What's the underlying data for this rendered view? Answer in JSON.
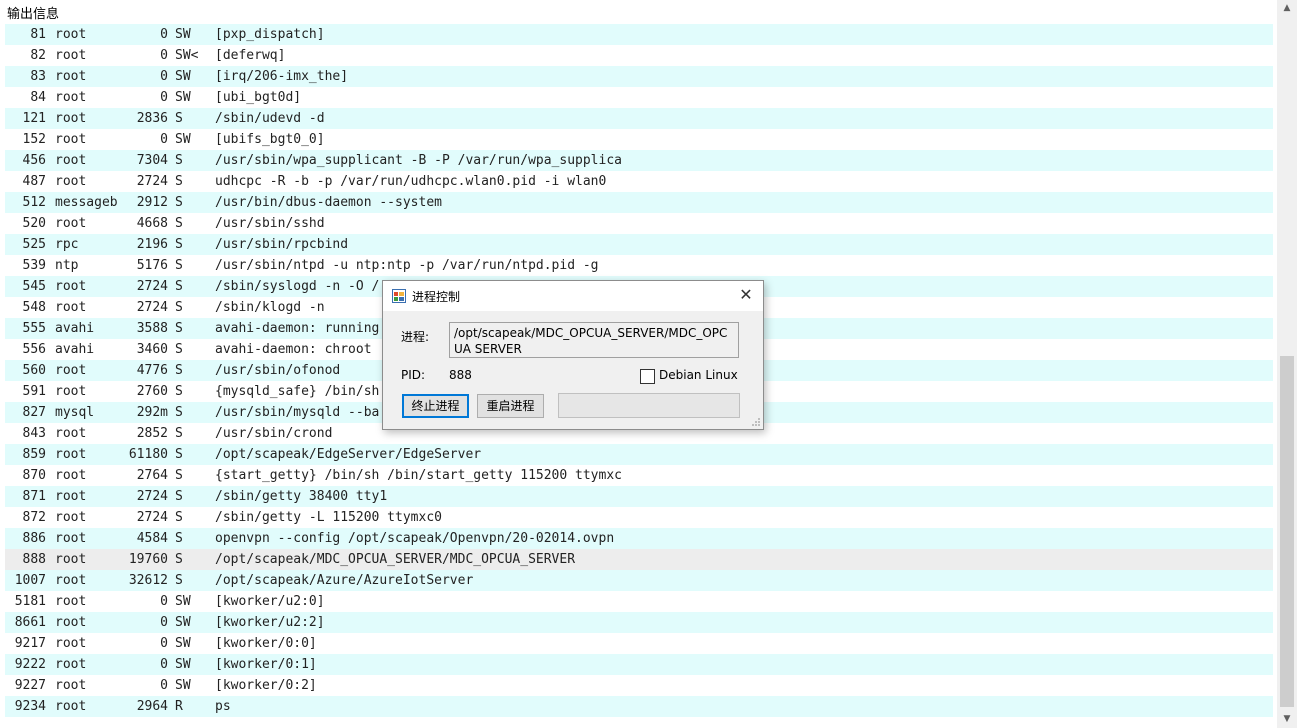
{
  "panel": {
    "title": "输出信息"
  },
  "processes": [
    {
      "pid": "81",
      "user": "root",
      "vsz": "0",
      "stat": "SW",
      "command": "[pxp_dispatch]"
    },
    {
      "pid": "82",
      "user": "root",
      "vsz": "0",
      "stat": "SW<",
      "command": "[deferwq]"
    },
    {
      "pid": "83",
      "user": "root",
      "vsz": "0",
      "stat": "SW",
      "command": "[irq/206-imx_the]"
    },
    {
      "pid": "84",
      "user": "root",
      "vsz": "0",
      "stat": "SW",
      "command": "[ubi_bgt0d]"
    },
    {
      "pid": "121",
      "user": "root",
      "vsz": "2836",
      "stat": "S",
      "command": "/sbin/udevd -d"
    },
    {
      "pid": "152",
      "user": "root",
      "vsz": "0",
      "stat": "SW",
      "command": "[ubifs_bgt0_0]"
    },
    {
      "pid": "456",
      "user": "root",
      "vsz": "7304",
      "stat": "S",
      "command": "/usr/sbin/wpa_supplicant -B -P /var/run/wpa_supplica"
    },
    {
      "pid": "487",
      "user": "root",
      "vsz": "2724",
      "stat": "S",
      "command": "udhcpc -R -b -p /var/run/udhcpc.wlan0.pid -i wlan0"
    },
    {
      "pid": "512",
      "user": "messageb",
      "vsz": "2912",
      "stat": "S",
      "command": "/usr/bin/dbus-daemon --system"
    },
    {
      "pid": "520",
      "user": "root",
      "vsz": "4668",
      "stat": "S",
      "command": "/usr/sbin/sshd"
    },
    {
      "pid": "525",
      "user": "rpc",
      "vsz": "2196",
      "stat": "S",
      "command": "/usr/sbin/rpcbind"
    },
    {
      "pid": "539",
      "user": "ntp",
      "vsz": "5176",
      "stat": "S",
      "command": "/usr/sbin/ntpd -u ntp:ntp -p /var/run/ntpd.pid -g"
    },
    {
      "pid": "545",
      "user": "root",
      "vsz": "2724",
      "stat": "S",
      "command": "/sbin/syslogd -n -O /"
    },
    {
      "pid": "548",
      "user": "root",
      "vsz": "2724",
      "stat": "S",
      "command": "/sbin/klogd -n"
    },
    {
      "pid": "555",
      "user": "avahi",
      "vsz": "3588",
      "stat": "S",
      "command": "avahi-daemon: running"
    },
    {
      "pid": "556",
      "user": "avahi",
      "vsz": "3460",
      "stat": "S",
      "command": "avahi-daemon: chroot"
    },
    {
      "pid": "560",
      "user": "root",
      "vsz": "4776",
      "stat": "S",
      "command": "/usr/sbin/ofonod"
    },
    {
      "pid": "591",
      "user": "root",
      "vsz": "2760",
      "stat": "S",
      "command": "{mysqld_safe} /bin/sh"
    },
    {
      "pid": "827",
      "user": "mysql",
      "vsz": "292m",
      "stat": "S",
      "command": "/usr/sbin/mysqld --ba"
    },
    {
      "pid": "843",
      "user": "root",
      "vsz": "2852",
      "stat": "S",
      "command": "/usr/sbin/crond"
    },
    {
      "pid": "859",
      "user": "root",
      "vsz": "61180",
      "stat": "S",
      "command": "/opt/scapeak/EdgeServer/EdgeServer"
    },
    {
      "pid": "870",
      "user": "root",
      "vsz": "2764",
      "stat": "S",
      "command": "{start_getty} /bin/sh /bin/start_getty 115200 ttymxc"
    },
    {
      "pid": "871",
      "user": "root",
      "vsz": "2724",
      "stat": "S",
      "command": "/sbin/getty 38400 tty1"
    },
    {
      "pid": "872",
      "user": "root",
      "vsz": "2724",
      "stat": "S",
      "command": "/sbin/getty -L 115200 ttymxc0"
    },
    {
      "pid": "886",
      "user": "root",
      "vsz": "4584",
      "stat": "S",
      "command": "openvpn --config /opt/scapeak/Openvpn/20-02014.ovpn"
    },
    {
      "pid": "888",
      "user": "root",
      "vsz": "19760",
      "stat": "S",
      "command": "/opt/scapeak/MDC_OPCUA_SERVER/MDC_OPCUA_SERVER",
      "selected": true
    },
    {
      "pid": "1007",
      "user": "root",
      "vsz": "32612",
      "stat": "S",
      "command": "/opt/scapeak/Azure/AzureIotServer"
    },
    {
      "pid": "5181",
      "user": "root",
      "vsz": "0",
      "stat": "SW",
      "command": "[kworker/u2:0]"
    },
    {
      "pid": "8661",
      "user": "root",
      "vsz": "0",
      "stat": "SW",
      "command": "[kworker/u2:2]"
    },
    {
      "pid": "9217",
      "user": "root",
      "vsz": "0",
      "stat": "SW",
      "command": "[kworker/0:0]"
    },
    {
      "pid": "9222",
      "user": "root",
      "vsz": "0",
      "stat": "SW",
      "command": "[kworker/0:1]"
    },
    {
      "pid": "9227",
      "user": "root",
      "vsz": "0",
      "stat": "SW",
      "command": "[kworker/0:2]"
    },
    {
      "pid": "9234",
      "user": "root",
      "vsz": "2964",
      "stat": "R",
      "command": "ps"
    }
  ],
  "dialog": {
    "title": "进程控制",
    "process_label": "进程:",
    "process_value": "/opt/scapeak/MDC_OPCUA_SERVER/MDC_OPCUA SERVER",
    "pid_label": "PID:",
    "pid_value": "888",
    "checkbox_label": "Debian Linux",
    "checkbox_checked": false,
    "kill_button": "终止进程",
    "restart_button": "重启进程",
    "status_text": ""
  },
  "colors": {
    "row_stripe": "#e1fcfc",
    "row_selected": "#ededed",
    "focus_border": "#0078d7"
  },
  "icons": {
    "dialog_icon": "app-window-icon",
    "close": "close-icon",
    "scroll_up": "chevron-up-icon",
    "scroll_down": "chevron-down-icon"
  }
}
